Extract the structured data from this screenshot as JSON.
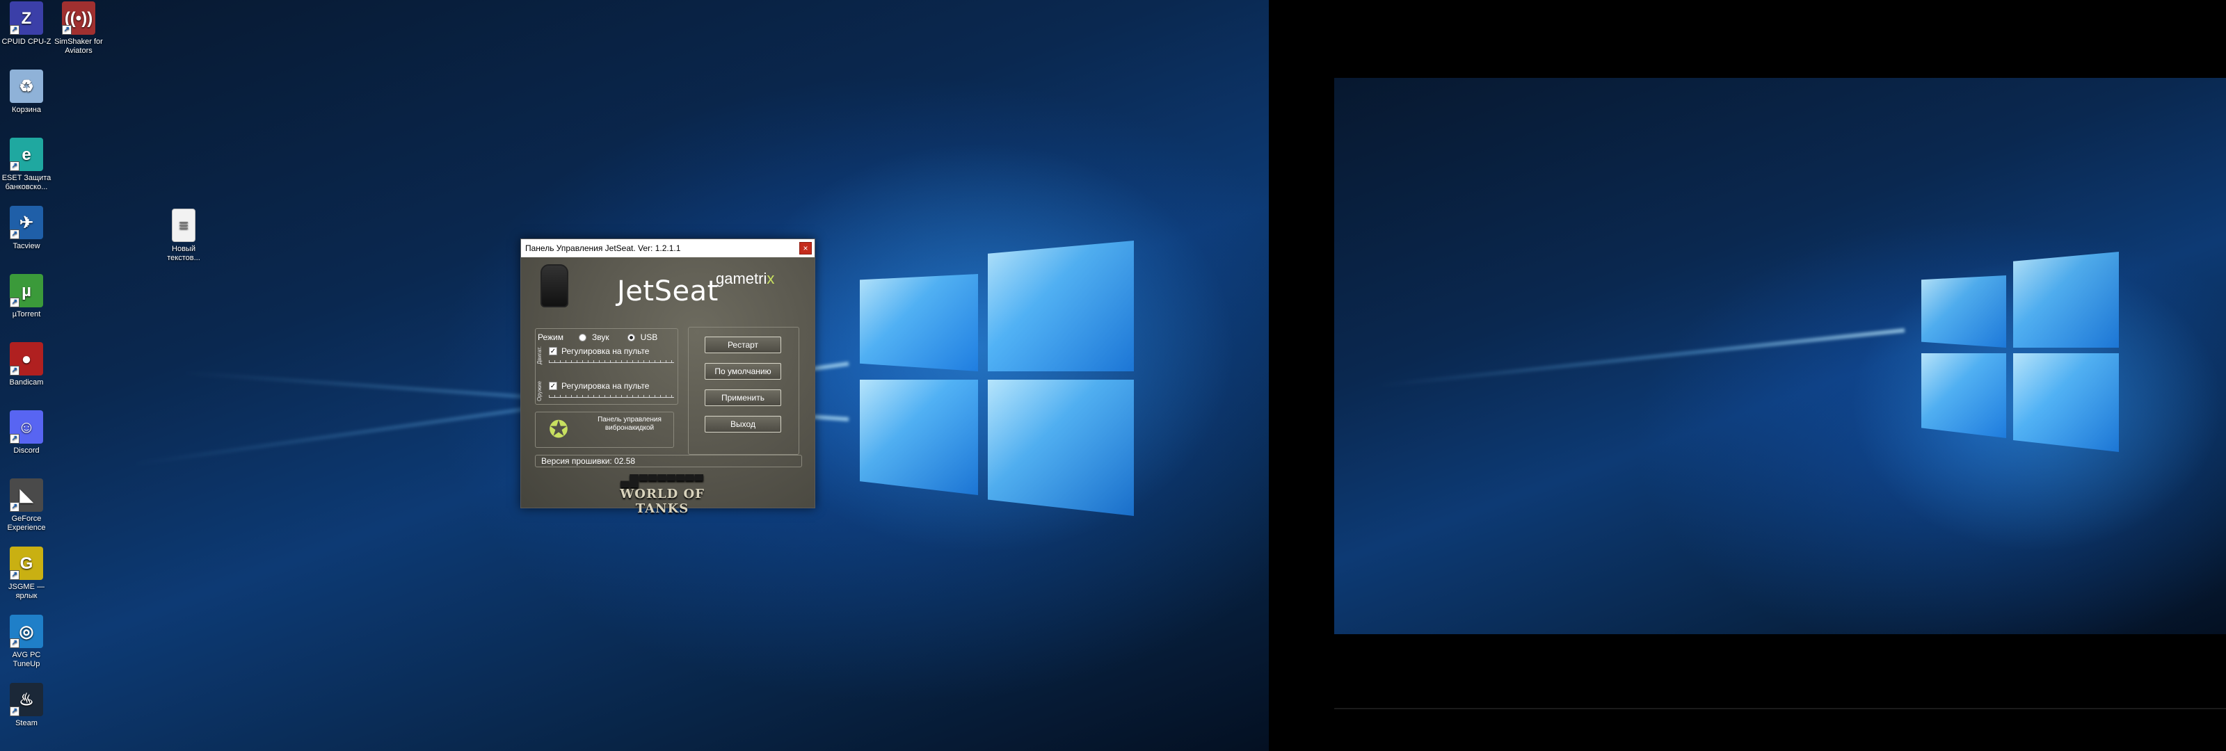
{
  "desktop_icons": [
    {
      "label": "CPUID CPU-Z",
      "icon": "cpuz-icon",
      "color": "#3b3fa8",
      "glyph": "Z"
    },
    {
      "label": "SimShaker for Aviators",
      "icon": "simshaker-icon",
      "color": "#a03030",
      "glyph": "((•))"
    },
    {
      "label": "Корзина",
      "icon": "recycle-bin-icon",
      "color": "#8fb2d8",
      "glyph": "♻"
    },
    {
      "label": "ESET Защита банковско...",
      "icon": "eset-icon",
      "color": "#1fa8a0",
      "glyph": "e"
    },
    {
      "label": "Tacview",
      "icon": "tacview-icon",
      "color": "#1f5fa8",
      "glyph": "✈"
    },
    {
      "label": "µTorrent",
      "icon": "utorrent-icon",
      "color": "#3b9a3a",
      "glyph": "µ"
    },
    {
      "label": "Bandicam",
      "icon": "bandicam-icon",
      "color": "#b02020",
      "glyph": "●"
    },
    {
      "label": "Discord",
      "icon": "discord-icon",
      "color": "#5865f2",
      "glyph": "☺"
    },
    {
      "label": "GeForce Experience",
      "icon": "geforce-icon",
      "color": "#4a4a4a",
      "glyph": "◣"
    },
    {
      "label": "JSGME — ярлык",
      "icon": "jsgme-icon",
      "color": "#c9b012",
      "glyph": "G"
    },
    {
      "label": "AVG PC TuneUp",
      "icon": "avg-tuneup-icon",
      "color": "#1f7fc8",
      "glyph": "◎"
    },
    {
      "label": "Steam",
      "icon": "steam-icon",
      "color": "#1b2838",
      "glyph": "♨"
    },
    {
      "label": "Новый текстов...",
      "icon": "text-file-icon",
      "color": "#f2f2f2",
      "glyph": "≡"
    }
  ],
  "jetseat": {
    "title": "Панель Управления JetSeat. Ver: 1.2.1.1",
    "brand": "JetSeat",
    "brand_sub": "gametri",
    "brand_sub_x": "x",
    "mode_label": "Режим",
    "mode_options": [
      "Звук",
      "USB"
    ],
    "selected_mode": "USB",
    "section1_label": "Двигат.",
    "section2_label": "Оружие",
    "check1_label": "Регулировка на пульте",
    "check2_label": "Регулировка на пульте",
    "check1_checked": true,
    "check2_checked": true,
    "buttons": [
      "Рестарт",
      "По умолчанию",
      "Применить",
      "Выход"
    ],
    "vibro_text": "Панель управления вибронакидкой",
    "firmware_label": "Версия прошивки: 02.58",
    "wot_logo": "WORLD OF TANKS",
    "close_glyph": "×"
  },
  "colors": {
    "desktop_blue": "#0d3a74",
    "window_body": "#55534a",
    "close_red": "#c42b1c",
    "accent_green": "#c8e060"
  }
}
